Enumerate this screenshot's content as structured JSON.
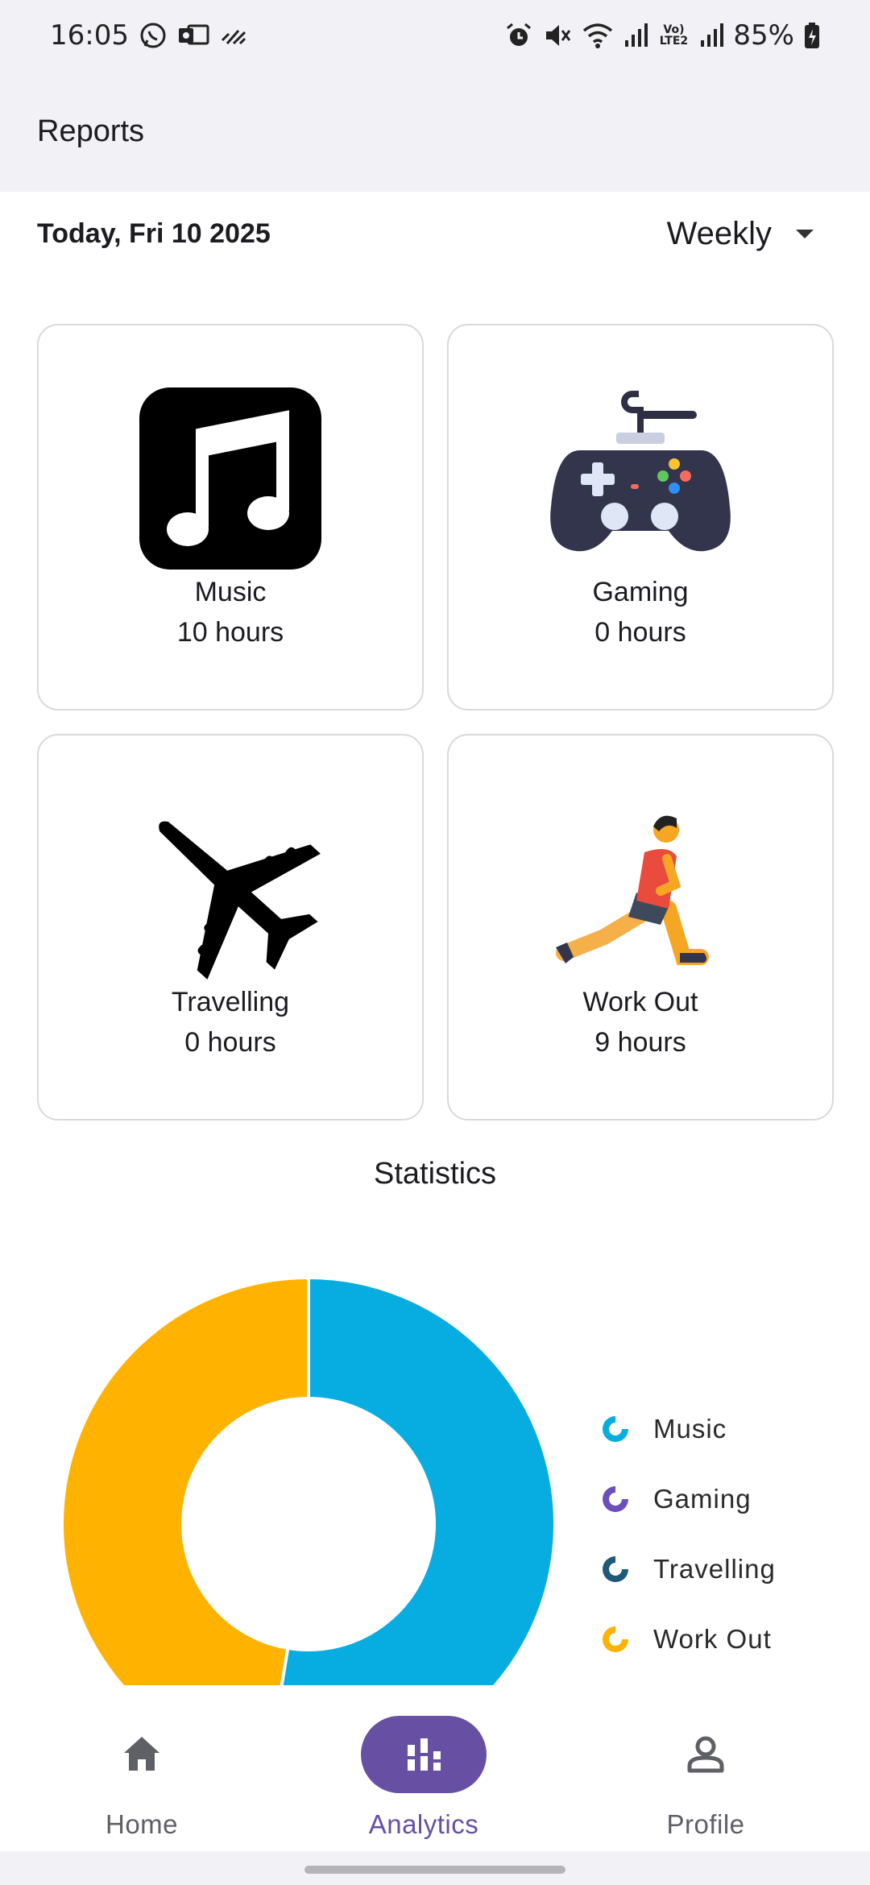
{
  "status_bar": {
    "time": "16:05",
    "battery": "85%",
    "network_label": "Vo) LTE2",
    "left_icons": [
      "whatsapp-icon",
      "outlook-icon",
      "data-saver-icon"
    ],
    "right_icons": [
      "alarm-icon",
      "mute-icon",
      "wifi-icon",
      "signal-icon",
      "signal-icon",
      "battery-icon"
    ]
  },
  "app_bar": {
    "title": "Reports"
  },
  "date_row": {
    "date": "Today, Fri 10 2025",
    "period": "Weekly"
  },
  "activities": [
    {
      "label": "Music",
      "value": "10 hours",
      "hours": 10,
      "icon": "music-note-icon"
    },
    {
      "label": "Gaming",
      "value": "0 hours",
      "hours": 0,
      "icon": "game-controller-icon"
    },
    {
      "label": "Travelling",
      "value": "0 hours",
      "hours": 0,
      "icon": "airplane-icon"
    },
    {
      "label": "Work Out",
      "value": "9 hours",
      "hours": 9,
      "icon": "stretching-person-icon"
    }
  ],
  "statistics": {
    "title": "Statistics"
  },
  "chart_data": {
    "type": "pie",
    "donut": true,
    "categories": [
      "Music",
      "Gaming",
      "Travelling",
      "Work Out"
    ],
    "values": [
      10,
      0,
      0,
      9
    ],
    "colors": [
      "#07ade0",
      "#6b4fbb",
      "#1f5878",
      "#ffb300"
    ],
    "legend_position": "right"
  },
  "bottom_nav": {
    "items": [
      {
        "label": "Home",
        "icon": "home-icon",
        "active": false
      },
      {
        "label": "Analytics",
        "icon": "bar-chart-icon",
        "active": true
      },
      {
        "label": "Profile",
        "icon": "profile-icon",
        "active": false
      }
    ]
  }
}
